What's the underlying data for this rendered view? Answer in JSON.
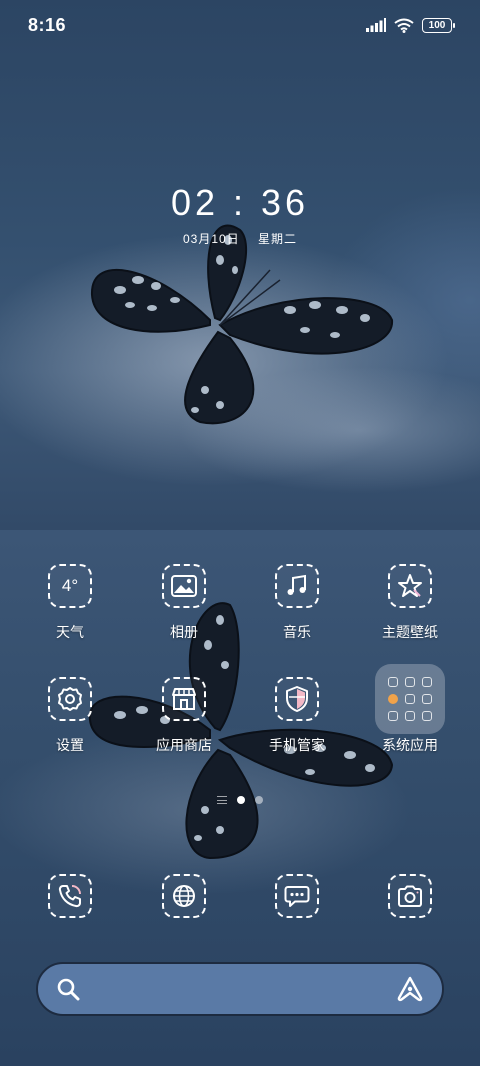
{
  "status_bar": {
    "time": "8:16",
    "battery": "100",
    "icons": [
      "signal-icon",
      "wifi-icon",
      "battery-icon"
    ]
  },
  "clock_widget": {
    "time": "02 : 36",
    "date": "03月10日",
    "weekday": "星期二"
  },
  "apps": [
    {
      "label": "天气",
      "icon": "weather-icon",
      "badge_text": "4°"
    },
    {
      "label": "相册",
      "icon": "gallery-icon"
    },
    {
      "label": "音乐",
      "icon": "music-icon"
    },
    {
      "label": "主题壁纸",
      "icon": "theme-star-icon"
    },
    {
      "label": "设置",
      "icon": "gear-icon"
    },
    {
      "label": "应用商店",
      "icon": "store-icon"
    },
    {
      "label": "手机管家",
      "icon": "shield-icon"
    },
    {
      "label": "系统应用",
      "icon": "folder-icon"
    }
  ],
  "page_indicator": {
    "pages": 2,
    "active": 1
  },
  "dock": [
    {
      "icon": "phone-icon"
    },
    {
      "icon": "browser-globe-icon"
    },
    {
      "icon": "messages-icon"
    },
    {
      "icon": "camera-icon"
    }
  ],
  "search_bar": {
    "left_icon": "search-icon",
    "right_icon": "assistant-icon"
  },
  "colors": {
    "wallpaper_base": "#2d4564",
    "search_bar_bg": "#5a7aa6",
    "folder_accent": "#f1a34a"
  }
}
